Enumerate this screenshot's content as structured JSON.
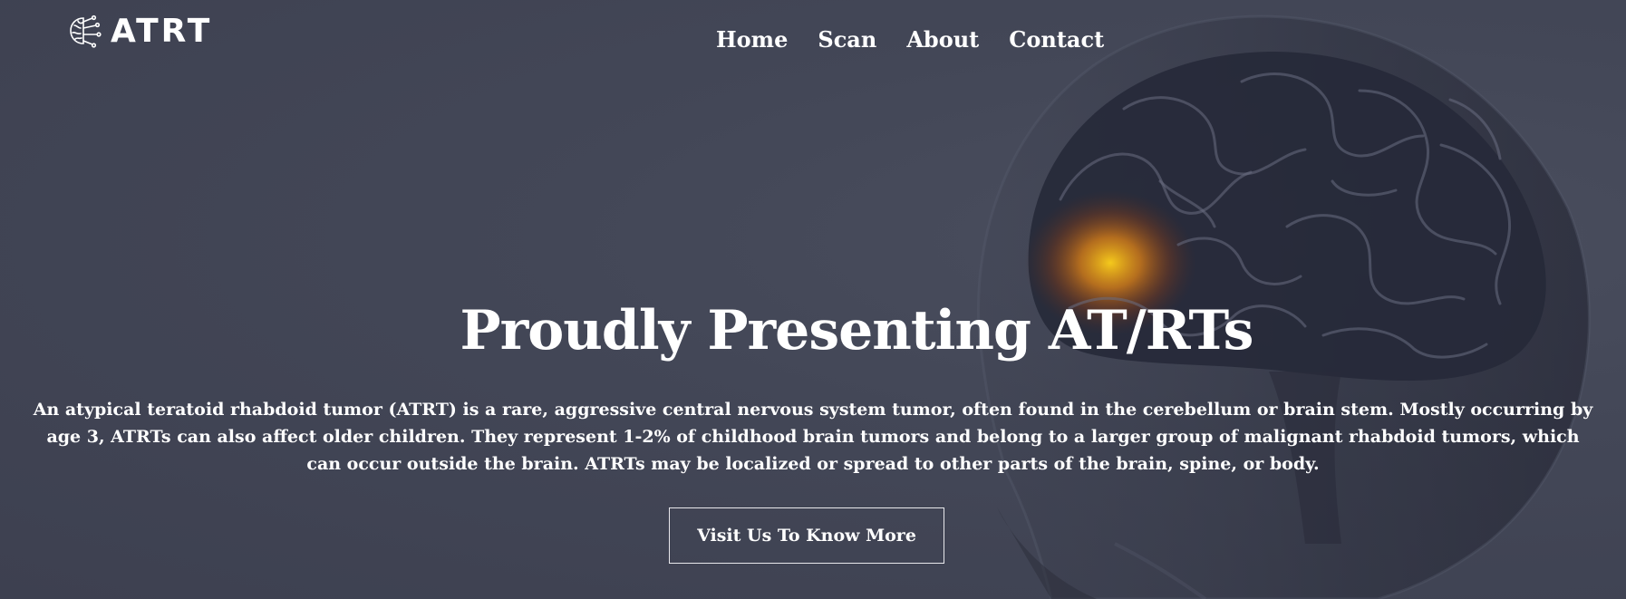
{
  "brand": {
    "name": "ATRT",
    "logo_icon": "brain-circuit-icon"
  },
  "nav": {
    "items": [
      {
        "label": "Home"
      },
      {
        "label": "Scan"
      },
      {
        "label": "About"
      },
      {
        "label": "Contact"
      }
    ]
  },
  "hero": {
    "title": "Proudly Presenting AT/RTs",
    "description": "An atypical teratoid rhabdoid tumor (ATRT) is a rare, aggressive central nervous system tumor, often found in the cerebellum or brain stem. Mostly occurring by age 3, ATRTs can also affect older children. They represent 1-2% of childhood brain tumors and belong to a larger group of malignant rhabdoid tumors, which can occur outside the brain. ATRTs may be localized or spread to other parts of the brain, spine, or body.",
    "cta_label": "Visit Us To Know More",
    "background_image": "head-brain-xray-illustration"
  },
  "colors": {
    "background": "#434757",
    "text": "#ffffff",
    "highlight": "#ff9a1e",
    "brain": "#2a2d3c"
  }
}
